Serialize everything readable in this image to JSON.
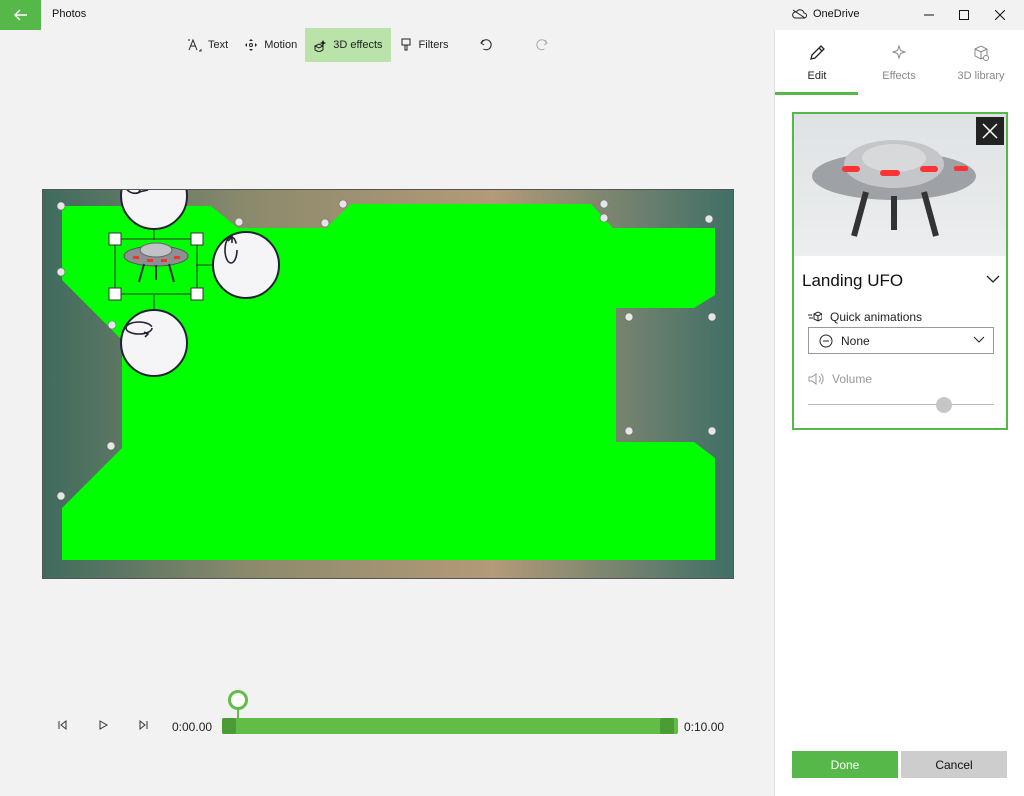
{
  "window": {
    "app_title": "Photos",
    "onedrive_label": "OneDrive",
    "accent_color": "#57b84a"
  },
  "toolbar": {
    "text_label": "Text",
    "motion_label": "Motion",
    "effects3d_label": "3D effects",
    "filters_label": "Filters"
  },
  "timeline": {
    "start_time": "0:00.00",
    "end_time": "0:10.00"
  },
  "panel": {
    "tabs": [
      {
        "label": "Edit"
      },
      {
        "label": "Effects"
      },
      {
        "label": "3D library"
      }
    ],
    "model_title": "Landing UFO",
    "quick_animations_label": "Quick animations",
    "quick_animations_value": "None",
    "volume_label": "Volume",
    "done_label": "Done",
    "cancel_label": "Cancel"
  }
}
